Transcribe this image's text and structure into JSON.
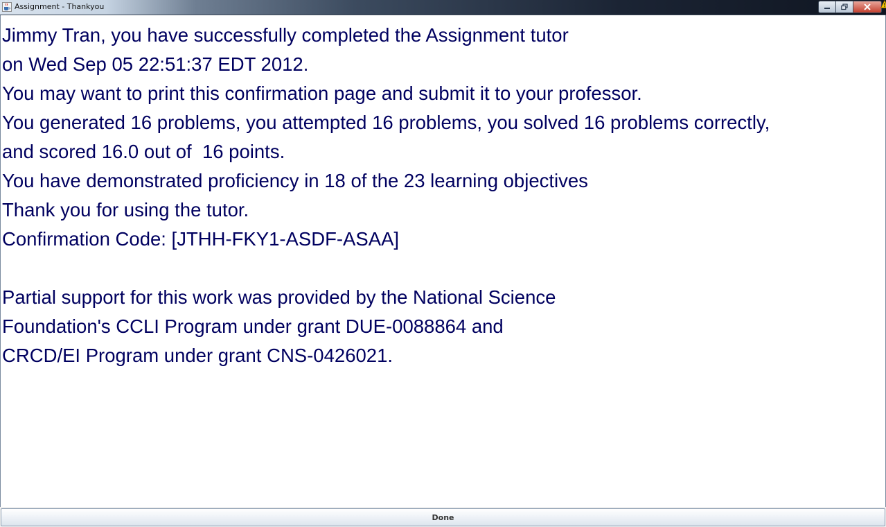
{
  "window": {
    "title": "Assignment - Thankyou",
    "app_icon": "java-cup-icon",
    "controls": [
      "minimize-icon",
      "maximize-icon",
      "close-icon"
    ]
  },
  "message": {
    "lines": [
      "Jimmy Tran, you have successfully completed the Assignment tutor",
      "on Wed Sep 05 22:51:37 EDT 2012.",
      "You may want to print this confirmation page and submit it to your professor.",
      "You generated 16 problems, you attempted 16 problems, you solved 16 problems correctly,",
      "and scored 16.0 out of  16 points.",
      "You have demonstrated proficiency in 18 of the 23 learning objectives",
      "Thank you for using the tutor.",
      "Confirmation Code: [JTHH-FKY1-ASDF-ASAA]",
      "",
      "Partial support for this work was provided by the National Science",
      "Foundation's CCLI Program under grant DUE-0088864 and",
      "CRCD/EI Program under grant CNS-0426021."
    ],
    "text_color": "#00005f"
  },
  "footer": {
    "done_label": "Done"
  }
}
